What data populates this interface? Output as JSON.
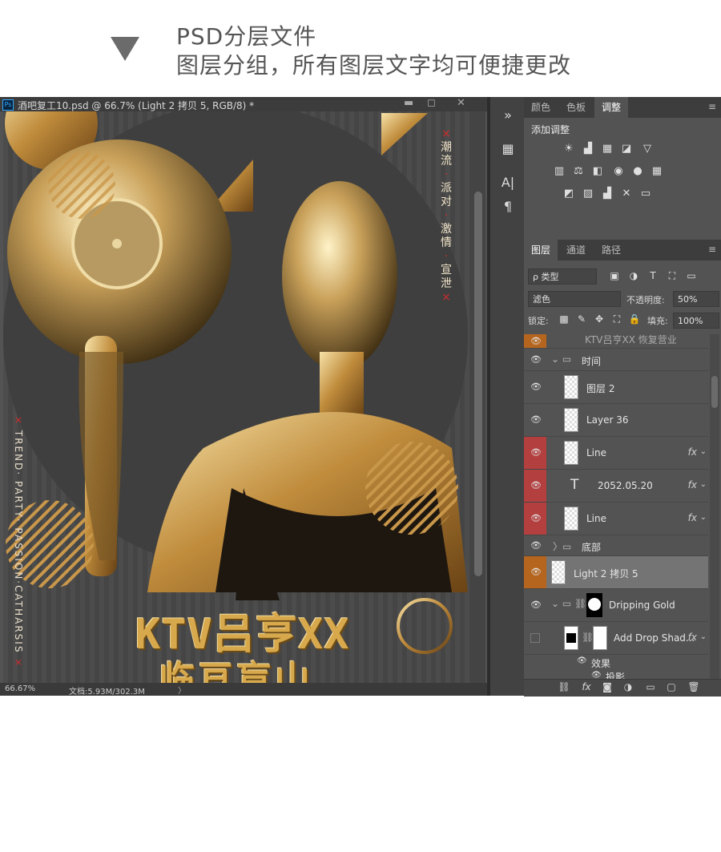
{
  "header": {
    "line1": "PSD分层文件",
    "line2": "图层分组，所有图层文字均可便捷更改"
  },
  "document": {
    "title": "酒吧复工10.psd @ 66.7% (Light 2 拷贝 5, RGB/8) *",
    "ps_badge": "Ps",
    "minimize": "▬",
    "maximize": "◻",
    "close": "✕",
    "zoom": "66.67%",
    "doc_size": "文档:5.93M/302.3M",
    "status_arrow": "〉"
  },
  "poster": {
    "vertical_cn": [
      "潮",
      "流",
      "派",
      "对",
      "激",
      "情",
      "宣",
      "泄"
    ],
    "vertical_sep": "·",
    "x_mark": "×",
    "vertical_en": "TREND· PARTY· PASSION·CATHARSIS",
    "title1": "KTV吕亨XX",
    "title2": "临亘盲山",
    "colors": {
      "gold": "#d7a94c",
      "circle_bg": "#3f3f3f",
      "stripe": "#5e5e5e"
    }
  },
  "tools": [
    "»",
    "▦",
    "A|",
    "¶"
  ],
  "adjust_panel": {
    "tabs": [
      "颜色",
      "色板",
      "调整"
    ],
    "active_tab": "调整",
    "title": "添加调整",
    "menu_icon": "≡",
    "row1": [
      "☀",
      "▟",
      "▦",
      "◪",
      "▽"
    ],
    "row2": [
      "▥",
      "⚖",
      "◧",
      "◉",
      "●",
      "▦"
    ],
    "row3": [
      "◩",
      "▨",
      "▟",
      "✕",
      "▭"
    ]
  },
  "layers_panel": {
    "tabs": [
      "图层",
      "通道",
      "路径"
    ],
    "active_tab": "图层",
    "menu_icon": "≡",
    "filter_label": "ρ 类型",
    "filter_icons": [
      "▣",
      "◑",
      "T",
      "⛶",
      "▭"
    ],
    "blend_mode": "滤色",
    "opacity_label": "不透明度:",
    "opacity_value": "50%",
    "lock_label": "锁定:",
    "lock_icons": [
      "▩",
      "✎",
      "✥",
      "⛶",
      "🔒"
    ],
    "fill_label": "填充:",
    "fill_value": "100%",
    "eye": "👁",
    "layers": [
      {
        "name": "KTV吕亨XX 恢复营业",
        "type": "text",
        "eye": true,
        "highlight": "orange"
      },
      {
        "name": "时间",
        "type": "group",
        "eye": true,
        "highlight": "none"
      },
      {
        "name": "图层 2",
        "type": "pixel",
        "eye": true,
        "highlight": "none"
      },
      {
        "name": "Layer 36",
        "type": "pixel",
        "eye": true,
        "highlight": "none"
      },
      {
        "name": "Line",
        "type": "smart",
        "eye": true,
        "highlight": "red",
        "fx": true
      },
      {
        "name": "2052.05.20",
        "type": "text",
        "eye": true,
        "highlight": "red",
        "fx": true
      },
      {
        "name": "Line",
        "type": "smart",
        "eye": true,
        "highlight": "red",
        "fx": true
      },
      {
        "name": "底部",
        "type": "group-collapsed",
        "eye": true,
        "highlight": "none"
      },
      {
        "name": "Light 2 拷贝 5",
        "type": "pixel",
        "eye": true,
        "highlight": "orange",
        "selected": true
      },
      {
        "name": "Dripping Gold",
        "type": "group-mask",
        "eye": true,
        "highlight": "none"
      },
      {
        "name": "Add Drop Shad...",
        "type": "pixel-mask",
        "eye": false,
        "highlight": "none",
        "fx": true
      },
      {
        "name": "效果",
        "type": "effect-group",
        "eye": true,
        "highlight": "none"
      },
      {
        "name": "投影",
        "type": "effect",
        "eye": true,
        "highlight": "none"
      }
    ],
    "fx_label": "fx",
    "fx_arrow": "⌄",
    "footer_icons": [
      "⛓",
      "fx",
      "◙",
      "◑",
      "▭",
      "▢",
      "🗑"
    ]
  }
}
